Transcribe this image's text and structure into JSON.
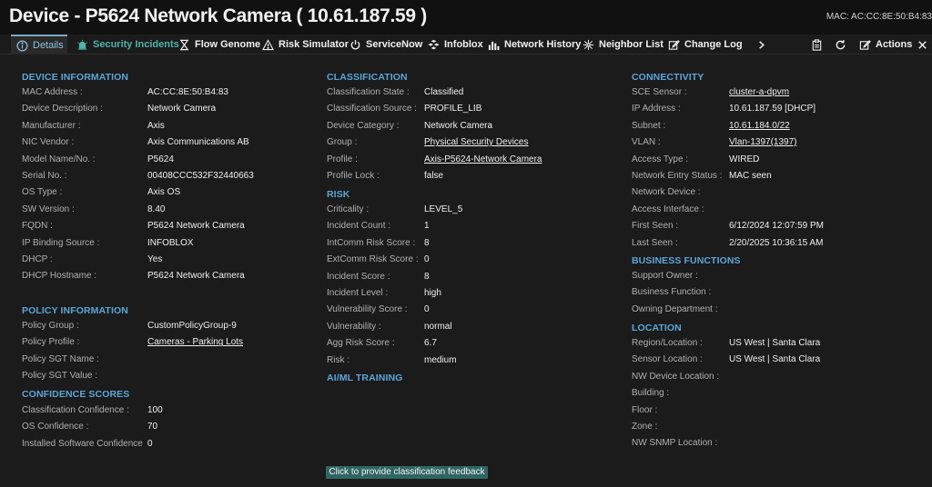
{
  "header": {
    "title": "Device - P5624 Network Camera ( 10.61.187.59 )",
    "mac_label": "MAC: AC:CC:8E:50:B4:83"
  },
  "tabs": [
    {
      "id": "details",
      "label": "Details",
      "icon": "info-icon",
      "active": true
    },
    {
      "id": "security-incidents",
      "label": "Security Incidents",
      "icon": "alarm-icon"
    },
    {
      "id": "flow-genome",
      "label": "Flow Genome",
      "icon": "hourglass-icon"
    },
    {
      "id": "risk-simulator",
      "label": "Risk Simulator",
      "icon": "warning-icon"
    },
    {
      "id": "servicenow",
      "label": "ServiceNow",
      "icon": "power-icon"
    },
    {
      "id": "infoblox",
      "label": "Infoblox",
      "icon": "cubes-icon"
    },
    {
      "id": "network-history",
      "label": "Network History",
      "icon": "bar-chart-icon"
    },
    {
      "id": "neighbor-list",
      "label": "Neighbor List",
      "icon": "network-icon"
    },
    {
      "id": "change-log",
      "label": "Change Log",
      "icon": "edit-log-icon"
    }
  ],
  "toolbar": {
    "actions_label": "Actions"
  },
  "device_information": {
    "heading": "DEVICE INFORMATION",
    "rows": [
      {
        "k": "MAC Address :",
        "v": "AC:CC:8E:50:B4:83"
      },
      {
        "k": "Device Description :",
        "v": "Network Camera"
      },
      {
        "k": "Manufacturer :",
        "v": "Axis"
      },
      {
        "k": "NIC Vendor :",
        "v": "Axis Communications AB"
      },
      {
        "k": "Model Name/No. :",
        "v": "P5624"
      },
      {
        "k": "Serial No. :",
        "v": "00408CCC532F32440663"
      },
      {
        "k": "OS Type :",
        "v": "Axis OS"
      },
      {
        "k": "SW Version :",
        "v": "8.40"
      },
      {
        "k": "FQDN :",
        "v": "P5624 Network Camera"
      },
      {
        "k": "IP Binding Source :",
        "v": "INFOBLOX"
      },
      {
        "k": "DHCP :",
        "v": "Yes"
      },
      {
        "k": "DHCP Hostname :",
        "v": "P5624 Network Camera"
      }
    ]
  },
  "policy_information": {
    "heading": "POLICY INFORMATION",
    "rows": [
      {
        "k": "Policy Group :",
        "v": "CustomPolicyGroup-9"
      },
      {
        "k": "Policy Profile :",
        "v": "Cameras - Parking Lots",
        "link": true
      },
      {
        "k": "Policy SGT Name :",
        "v": ""
      },
      {
        "k": "Policy SGT Value :",
        "v": ""
      }
    ]
  },
  "confidence_scores": {
    "heading": "CONFIDENCE SCORES",
    "rows": [
      {
        "k": "Classification Confidence :",
        "v": "100"
      },
      {
        "k": "OS Confidence :",
        "v": "70"
      },
      {
        "k": "Installed Software Confidence",
        "v": "0"
      }
    ]
  },
  "classification": {
    "heading": "CLASSIFICATION",
    "rows": [
      {
        "k": "Classification State :",
        "v": "Classified"
      },
      {
        "k": "Classification Source :",
        "v": "PROFILE_LIB"
      },
      {
        "k": "Device Category :",
        "v": "Network Camera"
      },
      {
        "k": "Group :",
        "v": "Physical Security Devices",
        "link": true
      },
      {
        "k": "Profile :",
        "v": "Axis-P5624-Network Camera",
        "link": true
      },
      {
        "k": "Profile Lock :",
        "v": "false"
      }
    ]
  },
  "risk": {
    "heading": "RISK",
    "rows": [
      {
        "k": "Criticality :",
        "v": "LEVEL_5"
      },
      {
        "k": "Incident Count :",
        "v": "1"
      },
      {
        "k": "IntComm Risk Score :",
        "v": "8"
      },
      {
        "k": "ExtComm Risk Score :",
        "v": "0"
      },
      {
        "k": "Incident Score :",
        "v": "8"
      },
      {
        "k": "Incident Level :",
        "v": "high"
      },
      {
        "k": "Vulnerability Score :",
        "v": "0"
      },
      {
        "k": "Vulnerability :",
        "v": "normal"
      },
      {
        "k": "Agg Risk Score :",
        "v": "6.7"
      },
      {
        "k": "Risk :",
        "v": "medium"
      }
    ]
  },
  "aiml_training": {
    "heading": "AI/ML TRAINING"
  },
  "connectivity": {
    "heading": "CONNECTIVITY",
    "rows": [
      {
        "k": "SCE Sensor :",
        "v": "cluster-a-dpvm",
        "link": true
      },
      {
        "k": "IP Address :",
        "v": "10.61.187.59 [DHCP]"
      },
      {
        "k": "Subnet :",
        "v": "10.61.184.0/22",
        "link": true
      },
      {
        "k": "VLAN :",
        "v": "Vlan-1397(1397)",
        "link": true
      },
      {
        "k": "Access Type :",
        "v": "WIRED"
      },
      {
        "k": "Network Entry Status :",
        "v": "MAC seen"
      },
      {
        "k": "Network Device :",
        "v": ""
      },
      {
        "k": "Access Interface :",
        "v": ""
      },
      {
        "k": "First Seen :",
        "v": "6/12/2024 12:07:59 PM"
      },
      {
        "k": "Last Seen :",
        "v": "2/20/2025 10:36:15 AM"
      }
    ]
  },
  "business_functions": {
    "heading": "BUSINESS FUNCTIONS",
    "rows": [
      {
        "k": "Support Owner :",
        "v": ""
      },
      {
        "k": "Business Function :",
        "v": ""
      },
      {
        "k": "Owning Department :",
        "v": ""
      }
    ]
  },
  "location": {
    "heading": "LOCATION",
    "rows": [
      {
        "k": "Region/Location :",
        "v": "US West | Santa Clara"
      },
      {
        "k": "Sensor Location :",
        "v": "US West | Santa Clara"
      },
      {
        "k": "NW Device Location :",
        "v": ""
      },
      {
        "k": "Building :",
        "v": ""
      },
      {
        "k": "Floor :",
        "v": ""
      },
      {
        "k": "Zone :",
        "v": ""
      },
      {
        "k": "NW SNMP Location :",
        "v": ""
      }
    ]
  },
  "feedback": {
    "label": "Click to provide classification feedback"
  }
}
